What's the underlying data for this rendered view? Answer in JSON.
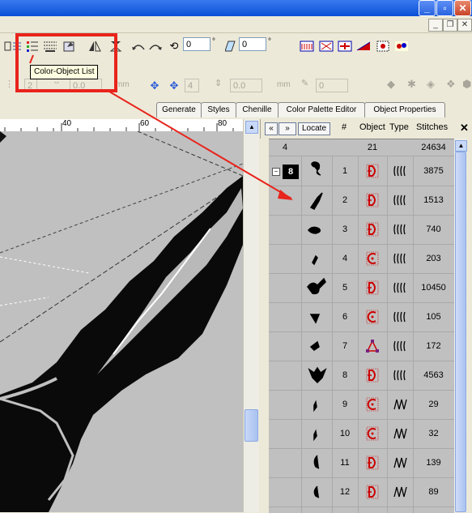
{
  "tooltip": "Color-Object List",
  "toolbar": {
    "angle_value": "0",
    "angle_unit": "°",
    "slant_value": "0",
    "slant_unit": "°"
  },
  "toolbar2": {
    "field_a": "2",
    "field_b": "0.0",
    "unit_a": "mm",
    "field_c": "4",
    "field_d": "0.0",
    "unit_b": "mm",
    "field_e": "0"
  },
  "tabs": [
    "Generate",
    "Styles",
    "Chenille",
    "Color Palette Editor",
    "Object Properties"
  ],
  "ruler": [
    "40",
    "60",
    "80"
  ],
  "list": {
    "locate_label": "Locate",
    "columns": [
      "#",
      "Object",
      "Type",
      "Stitches"
    ],
    "summary": {
      "colors": "4",
      "objects": "21",
      "stitches": "24634"
    },
    "color_badge": "8",
    "rows": [
      {
        "num": "1",
        "type": "d",
        "stitch_icon": "fill",
        "stitches": "3875"
      },
      {
        "num": "2",
        "type": "d",
        "stitch_icon": "fill",
        "stitches": "1513"
      },
      {
        "num": "3",
        "type": "d",
        "stitch_icon": "fill",
        "stitches": "740"
      },
      {
        "num": "4",
        "type": "c",
        "stitch_icon": "fill",
        "stitches": "203"
      },
      {
        "num": "5",
        "type": "d",
        "stitch_icon": "fill",
        "stitches": "10450"
      },
      {
        "num": "6",
        "type": "c",
        "stitch_icon": "fill",
        "stitches": "105"
      },
      {
        "num": "7",
        "type": "poly",
        "stitch_icon": "fill",
        "stitches": "172"
      },
      {
        "num": "8",
        "type": "d",
        "stitch_icon": "fill",
        "stitches": "4563"
      },
      {
        "num": "9",
        "type": "c",
        "stitch_icon": "satin",
        "stitches": "29"
      },
      {
        "num": "10",
        "type": "c",
        "stitch_icon": "satin",
        "stitches": "32"
      },
      {
        "num": "11",
        "type": "d",
        "stitch_icon": "satin",
        "stitches": "139"
      },
      {
        "num": "12",
        "type": "d",
        "stitch_icon": "satin",
        "stitches": "89"
      }
    ]
  },
  "colors": {
    "highlight": "#e8241c",
    "accent": "#cc0000"
  }
}
